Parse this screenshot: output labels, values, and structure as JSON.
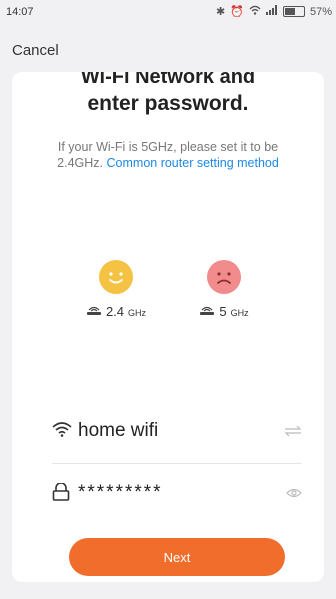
{
  "status_bar": {
    "time": "14:07",
    "battery_text": "57%",
    "battery_level": 0.57
  },
  "header": {
    "cancel_label": "Cancel"
  },
  "title": {
    "line1": "Wi-Fi Network and",
    "line2": "enter password."
  },
  "description": {
    "text": "If your Wi-Fi is 5GHz, please set it to be 2.4GHz.",
    "link": "Common router setting method"
  },
  "bands": [
    {
      "value": "2.4",
      "unit": "GHz",
      "status": "supported"
    },
    {
      "value": "5",
      "unit": "GHz",
      "status": "unsupported"
    }
  ],
  "form": {
    "ssid_value": "home wifi",
    "password_value": "*********"
  },
  "actions": {
    "next_label": "Next"
  },
  "colors": {
    "accent": "#f06d2c",
    "link": "#1e88e5",
    "good_face": "#f5c344",
    "bad_face": "#f28b8b"
  }
}
